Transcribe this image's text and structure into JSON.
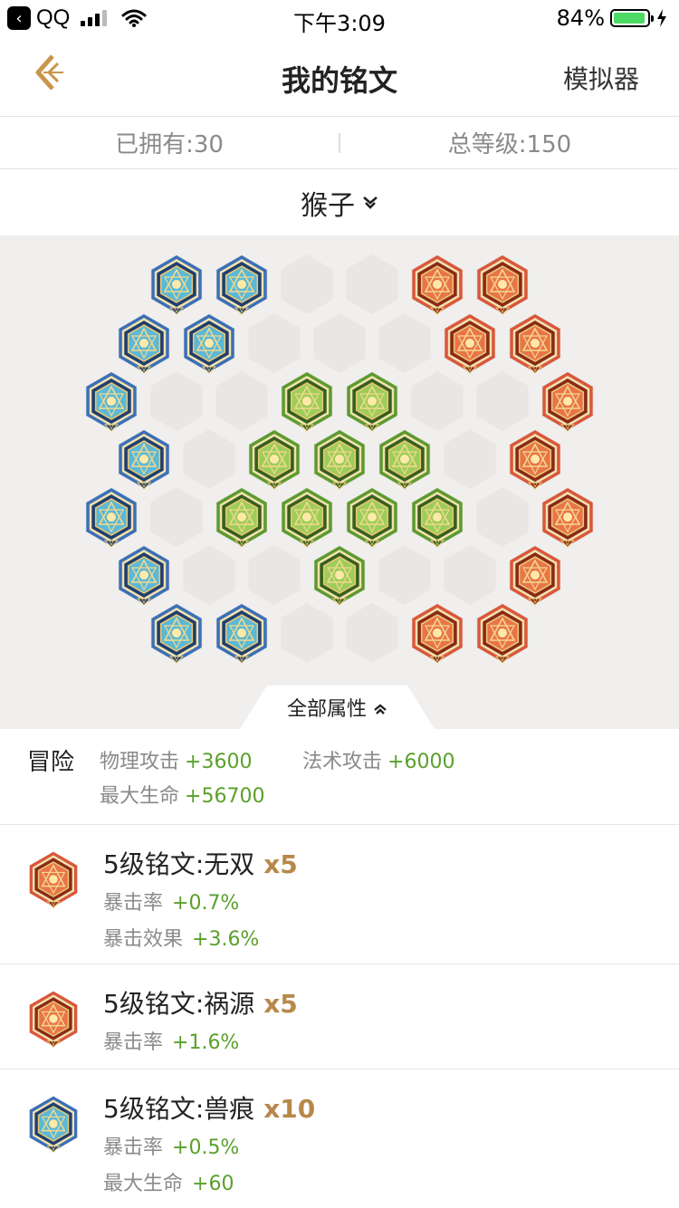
{
  "status_bar": {
    "carrier": "QQ",
    "time": "下午3:09",
    "battery": "84%"
  },
  "nav": {
    "title": "我的铭文",
    "right_action": "模拟器"
  },
  "summary": {
    "owned": "已拥有:30",
    "total_level": "总等级:150"
  },
  "hero": {
    "name": "猴子"
  },
  "board_tab": "全部属性",
  "colors": {
    "blue": "#3c6fb6",
    "green": "#5d9a2e",
    "red": "#d9573b",
    "accent": "#b8884a",
    "stat_value": "#5aa02c"
  },
  "attributes": {
    "category": "冒险",
    "stats": [
      {
        "name": "物理攻击",
        "value": "+3600"
      },
      {
        "name": "法术攻击",
        "value": "+6000"
      },
      {
        "name": "最大生命",
        "value": "+56700"
      }
    ]
  },
  "runes": [
    {
      "icon": "red-rune-icon",
      "title": "5级铭文:无双",
      "count": "x5",
      "stats": [
        {
          "name": "暴击率",
          "value": "+0.7%"
        },
        {
          "name": "暴击效果",
          "value": "+3.6%"
        }
      ]
    },
    {
      "icon": "red-rune-icon",
      "title": "5级铭文:祸源",
      "count": "x5",
      "stats": [
        {
          "name": "暴击率",
          "value": "+1.6%"
        }
      ]
    },
    {
      "icon": "blue-rune-icon",
      "title": "5级铭文:兽痕",
      "count": "x10",
      "stats": [
        {
          "name": "暴击率",
          "value": "+0.5%"
        },
        {
          "name": "最大生命",
          "value": "+60"
        }
      ]
    }
  ]
}
